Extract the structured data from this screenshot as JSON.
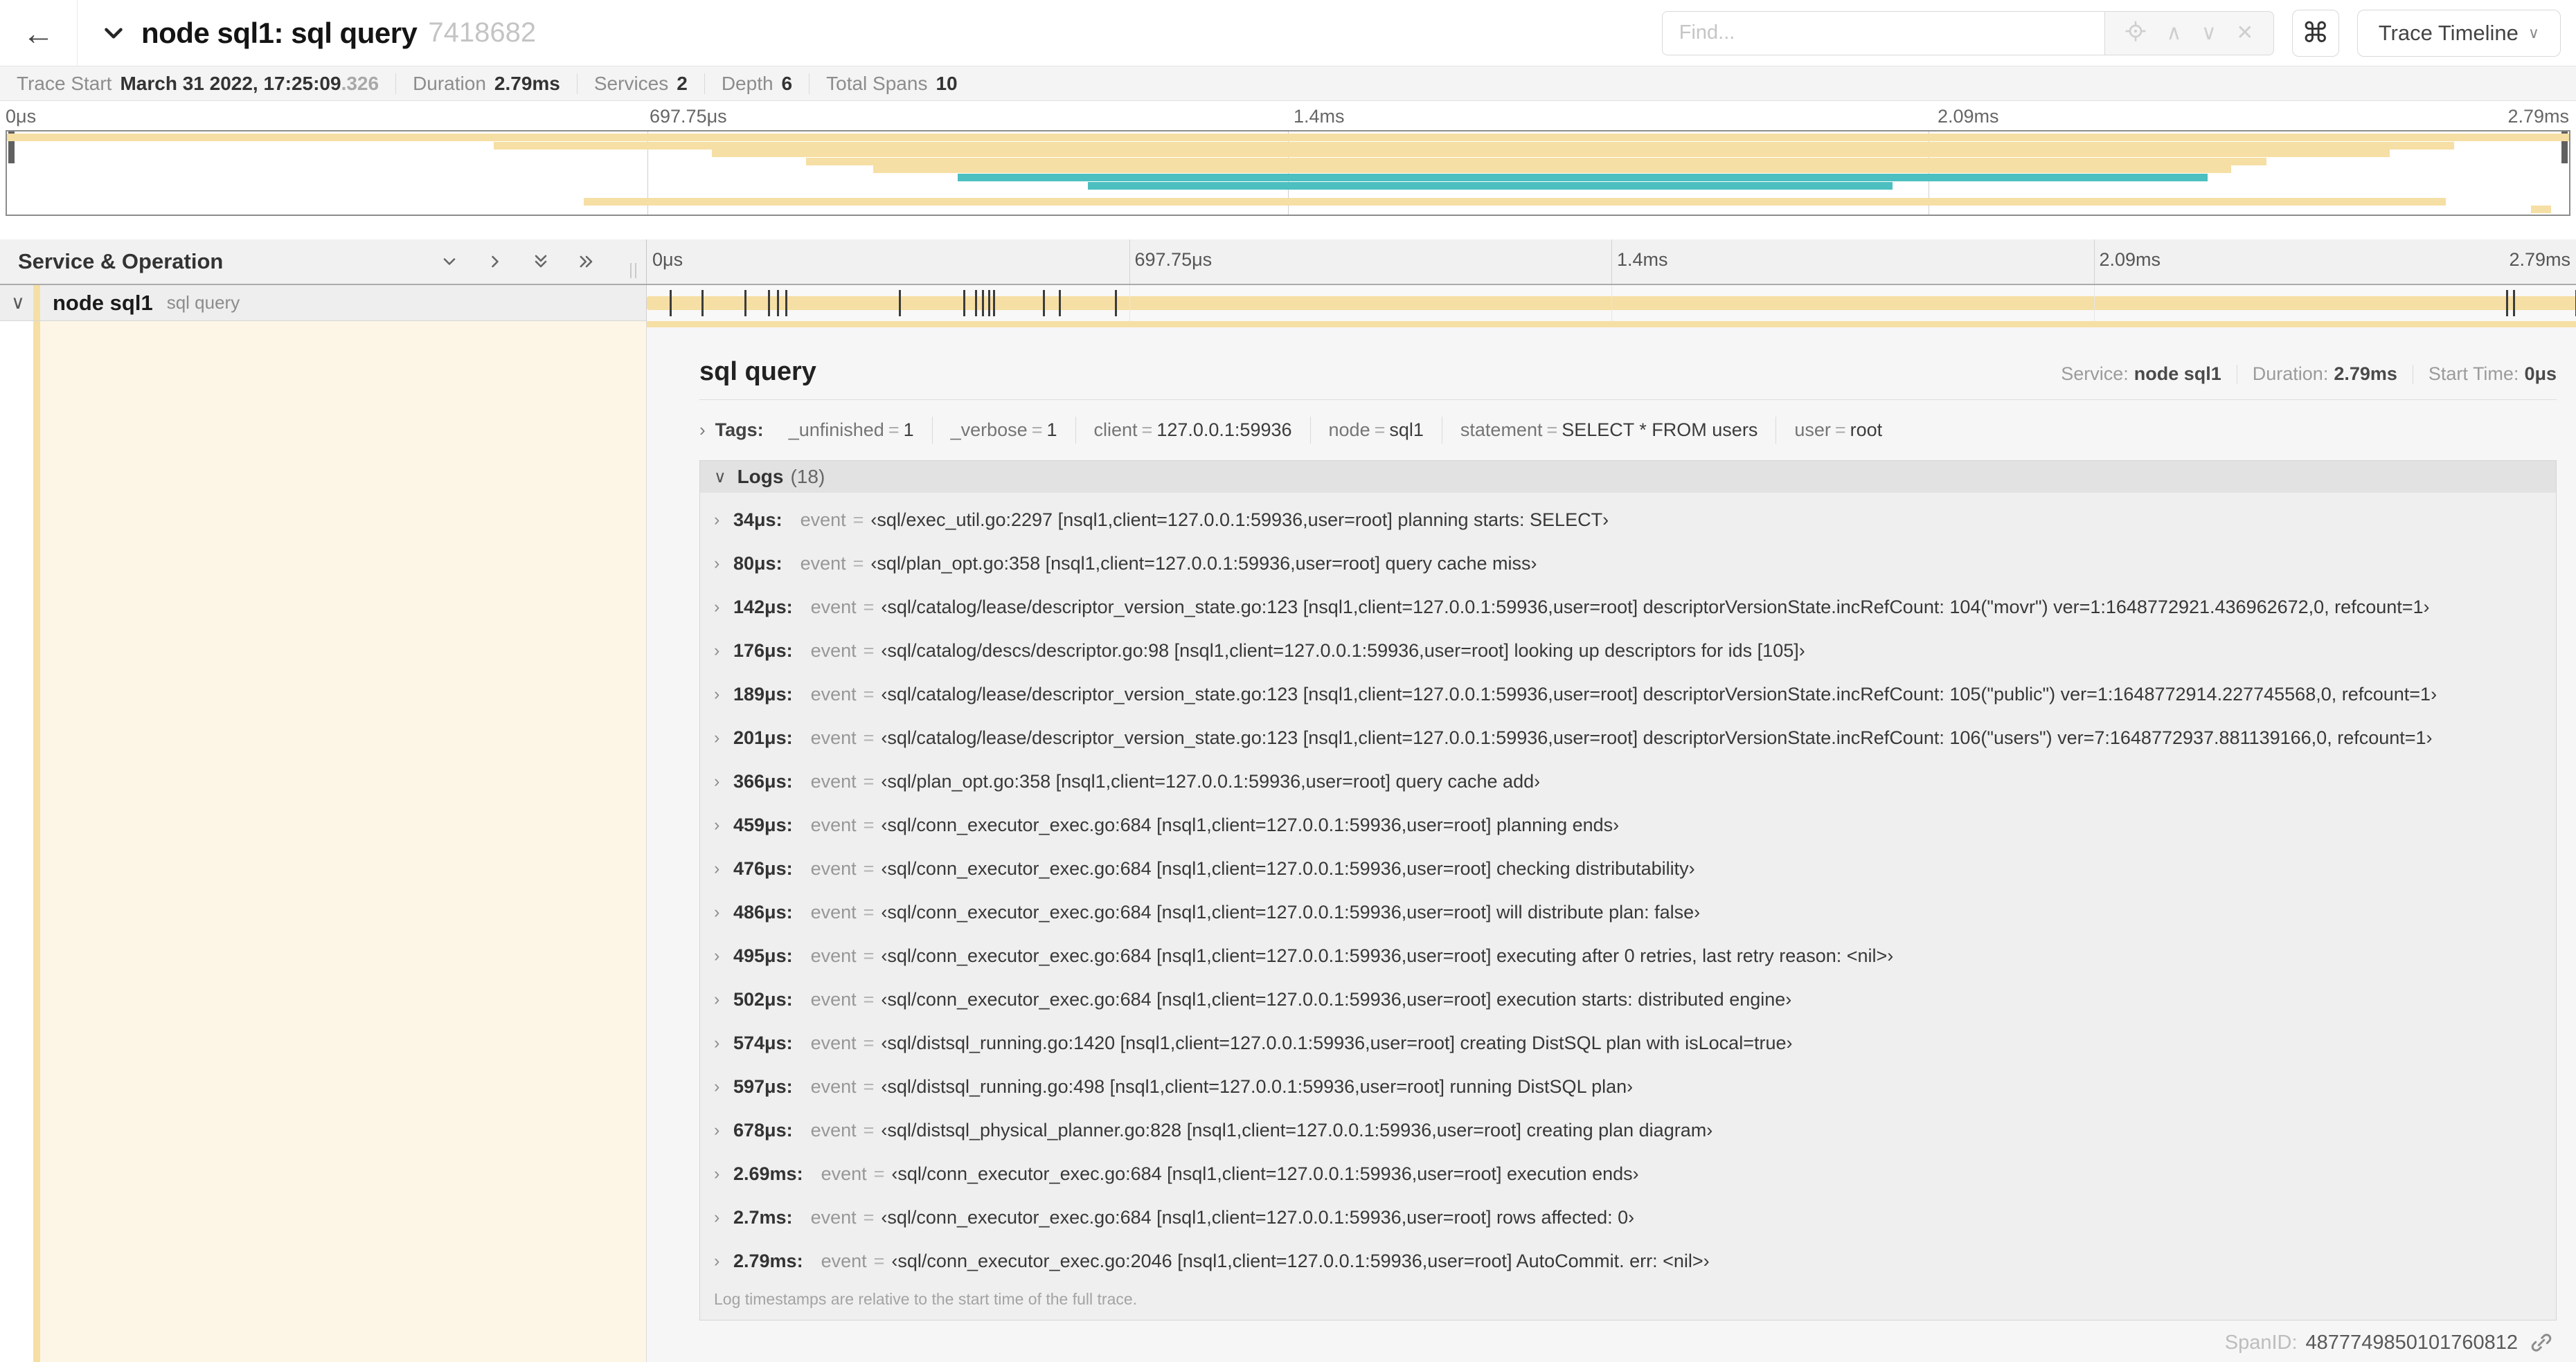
{
  "colors": {
    "tan": "#F6DFA4",
    "teal": "#4CBFC0",
    "cream": "#FDF6E7",
    "tick": "#3C3C3C"
  },
  "header": {
    "back_icon": "←",
    "title": "node sql1: sql query",
    "trace_id": "7418682",
    "find_placeholder": "Find...",
    "shortcut_label": "⌘",
    "view_selector_label": "Trace Timeline",
    "find_tools": [
      "aim-icon",
      "chevron-up-icon",
      "chevron-down-icon",
      "close-icon"
    ]
  },
  "summary": {
    "items": [
      {
        "label": "Trace Start",
        "value": "March 31 2022, 17:25:09",
        "suffix": ".326"
      },
      {
        "label": "Duration",
        "value": "2.79ms"
      },
      {
        "label": "Services",
        "value": "2"
      },
      {
        "label": "Depth",
        "value": "6"
      },
      {
        "label": "Total Spans",
        "value": "10"
      }
    ]
  },
  "timeline": {
    "ticks": [
      "0μs",
      "697.75μs",
      "1.4ms",
      "2.09ms",
      "2.79ms"
    ],
    "total_us": 2790,
    "left_header": "Service & Operation",
    "row": {
      "service": "node sql1",
      "operation": "sql query"
    }
  },
  "minimap": {
    "spans": [
      {
        "row": 0,
        "start": 0.0,
        "end": 1.0,
        "color": "tan"
      },
      {
        "row": 1,
        "start": 0.19,
        "end": 0.955,
        "color": "tan"
      },
      {
        "row": 2,
        "start": 0.275,
        "end": 0.93,
        "color": "tan"
      },
      {
        "row": 3,
        "start": 0.312,
        "end": 0.882,
        "color": "tan"
      },
      {
        "row": 4,
        "start": 0.338,
        "end": 0.868,
        "color": "tan"
      },
      {
        "row": 5,
        "start": 0.371,
        "end": 0.859,
        "color": "teal"
      },
      {
        "row": 6,
        "start": 0.422,
        "end": 0.736,
        "color": "teal"
      },
      {
        "row": 8,
        "start": 0.225,
        "end": 0.952,
        "color": "tan"
      },
      {
        "row": 9,
        "start": 0.985,
        "end": 0.993,
        "color": "tan"
      }
    ]
  },
  "detail": {
    "operation": "sql query",
    "service_label": "Service:",
    "service": "node sql1",
    "duration_label": "Duration:",
    "duration": "2.79ms",
    "start_label": "Start Time:",
    "start": "0μs",
    "tags_label": "Tags:",
    "tags": [
      {
        "key": "_unfinished",
        "value": "1"
      },
      {
        "key": "_verbose",
        "value": "1"
      },
      {
        "key": "client",
        "value": "127.0.0.1:59936"
      },
      {
        "key": "node",
        "value": "sql1"
      },
      {
        "key": "statement",
        "value": "SELECT * FROM users"
      },
      {
        "key": "user",
        "value": "root"
      }
    ],
    "logs_label": "Logs",
    "logs_count": "(18)",
    "logs": [
      {
        "t": 34,
        "time": "34μs:",
        "key": "event",
        "value": "‹sql/exec_util.go:2297 [nsql1,client=127.0.0.1:59936,user=root] planning starts: SELECT›"
      },
      {
        "t": 80,
        "time": "80μs:",
        "key": "event",
        "value": "‹sql/plan_opt.go:358 [nsql1,client=127.0.0.1:59936,user=root] query cache miss›"
      },
      {
        "t": 142,
        "time": "142μs:",
        "key": "event",
        "value": "‹sql/catalog/lease/descriptor_version_state.go:123 [nsql1,client=127.0.0.1:59936,user=root] descriptorVersionState.incRefCount: 104(\"movr\") ver=1:1648772921.436962672,0, refcount=1›"
      },
      {
        "t": 176,
        "time": "176μs:",
        "key": "event",
        "value": "‹sql/catalog/descs/descriptor.go:98 [nsql1,client=127.0.0.1:59936,user=root] looking up descriptors for ids [105]›"
      },
      {
        "t": 189,
        "time": "189μs:",
        "key": "event",
        "value": "‹sql/catalog/lease/descriptor_version_state.go:123 [nsql1,client=127.0.0.1:59936,user=root] descriptorVersionState.incRefCount: 105(\"public\") ver=1:1648772914.227745568,0, refcount=1›"
      },
      {
        "t": 201,
        "time": "201μs:",
        "key": "event",
        "value": "‹sql/catalog/lease/descriptor_version_state.go:123 [nsql1,client=127.0.0.1:59936,user=root] descriptorVersionState.incRefCount: 106(\"users\") ver=7:1648772937.881139166,0, refcount=1›"
      },
      {
        "t": 366,
        "time": "366μs:",
        "key": "event",
        "value": "‹sql/plan_opt.go:358 [nsql1,client=127.0.0.1:59936,user=root] query cache add›"
      },
      {
        "t": 459,
        "time": "459μs:",
        "key": "event",
        "value": "‹sql/conn_executor_exec.go:684 [nsql1,client=127.0.0.1:59936,user=root] planning ends›"
      },
      {
        "t": 476,
        "time": "476μs:",
        "key": "event",
        "value": "‹sql/conn_executor_exec.go:684 [nsql1,client=127.0.0.1:59936,user=root] checking distributability›"
      },
      {
        "t": 486,
        "time": "486μs:",
        "key": "event",
        "value": "‹sql/conn_executor_exec.go:684 [nsql1,client=127.0.0.1:59936,user=root] will distribute plan: false›"
      },
      {
        "t": 495,
        "time": "495μs:",
        "key": "event",
        "value": "‹sql/conn_executor_exec.go:684 [nsql1,client=127.0.0.1:59936,user=root] executing after 0 retries, last retry reason: <nil>›"
      },
      {
        "t": 502,
        "time": "502μs:",
        "key": "event",
        "value": "‹sql/conn_executor_exec.go:684 [nsql1,client=127.0.0.1:59936,user=root] execution starts: distributed engine›"
      },
      {
        "t": 574,
        "time": "574μs:",
        "key": "event",
        "value": "‹sql/distsql_running.go:1420 [nsql1,client=127.0.0.1:59936,user=root] creating DistSQL plan with isLocal=true›"
      },
      {
        "t": 597,
        "time": "597μs:",
        "key": "event",
        "value": "‹sql/distsql_running.go:498 [nsql1,client=127.0.0.1:59936,user=root] running DistSQL plan›"
      },
      {
        "t": 678,
        "time": "678μs:",
        "key": "event",
        "value": "‹sql/distsql_physical_planner.go:828 [nsql1,client=127.0.0.1:59936,user=root] creating plan diagram›"
      },
      {
        "t": 2690,
        "time": "2.69ms:",
        "key": "event",
        "value": "‹sql/conn_executor_exec.go:684 [nsql1,client=127.0.0.1:59936,user=root] execution ends›"
      },
      {
        "t": 2700,
        "time": "2.7ms:",
        "key": "event",
        "value": "‹sql/conn_executor_exec.go:684 [nsql1,client=127.0.0.1:59936,user=root] rows affected: 0›"
      },
      {
        "t": 2790,
        "time": "2.79ms:",
        "key": "event",
        "value": "‹sql/conn_executor_exec.go:2046 [nsql1,client=127.0.0.1:59936,user=root] AutoCommit. err: <nil>›"
      }
    ],
    "note": "Log timestamps are relative to the start time of the full trace.",
    "spanid_label": "SpanID:",
    "spanid": "4877749850101760812"
  }
}
